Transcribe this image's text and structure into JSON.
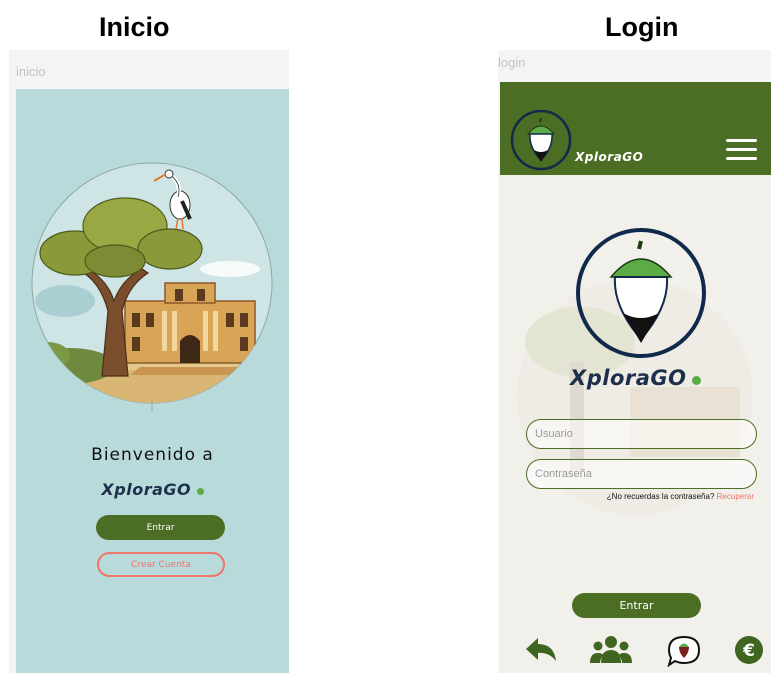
{
  "headings": {
    "inicio": "Inicio",
    "login": "Login"
  },
  "inicio": {
    "screen_title": "inicio",
    "welcome": "Bienvenido a",
    "brand": "XploraGO",
    "enter_label": "Entrar",
    "create_label": "Crear Cuenta"
  },
  "login": {
    "screen_title": "login",
    "brand_small": "XploraGO",
    "brand": "XploraGO",
    "username_placeholder": "Usuario",
    "password_placeholder": "Contraseña",
    "forgot_text": "¿No recuerdas la contraseña?",
    "recover_link": "Recuperar",
    "enter_label": "Entrar",
    "bottom_icons": [
      "back-arrow-icon",
      "group-icon",
      "chat-location-icon",
      "euro-icon"
    ]
  },
  "colors": {
    "brand_green": "#4c6d24",
    "sky": "#b8dadb",
    "coral": "#f0756a",
    "navy": "#0f2a4a",
    "acorn_green": "#5cab46"
  }
}
